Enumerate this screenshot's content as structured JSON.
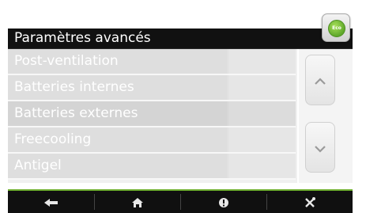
{
  "header": {
    "title": "Paramètres avancés",
    "eco_badge_text": "Eco"
  },
  "menu": {
    "items": [
      {
        "label": "Post-ventilation",
        "selected": false
      },
      {
        "label": "Batteries internes",
        "selected": false
      },
      {
        "label": "Batteries externes",
        "selected": true
      },
      {
        "label": "Freecooling",
        "selected": false
      },
      {
        "label": "Antigel",
        "selected": false
      }
    ]
  },
  "scroll": {
    "up_icon": "chevron-up-icon",
    "down_icon": "chevron-down-icon"
  },
  "toolbar": {
    "buttons": [
      {
        "icon": "back-arrow-icon"
      },
      {
        "icon": "home-icon"
      },
      {
        "icon": "info-icon"
      },
      {
        "icon": "settings-tools-icon"
      }
    ]
  },
  "colors": {
    "accent_green": "#6fae2f",
    "title_bar": "#111111",
    "toolbar": "#101010",
    "list_row": "#dedede"
  }
}
